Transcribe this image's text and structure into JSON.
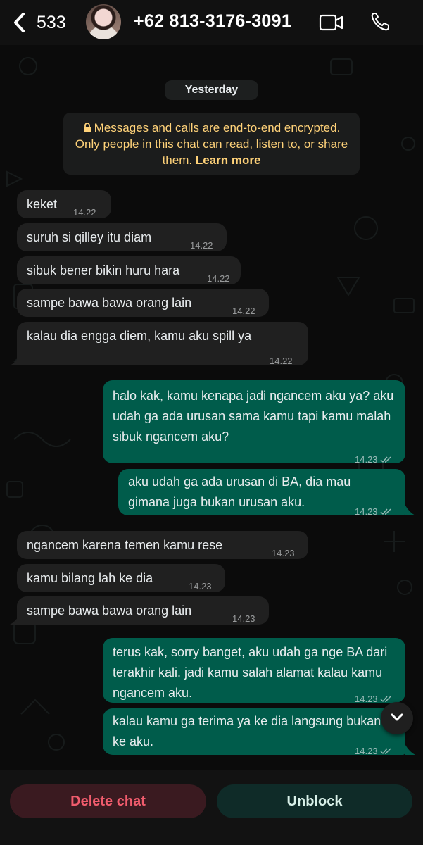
{
  "header": {
    "back_count": "533",
    "contact_name": "+62 813-3176-3091",
    "avatar_icon": "avatar-photo",
    "video_icon": "video-call-icon",
    "phone_icon": "voice-call-icon"
  },
  "chat": {
    "date_label": "Yesterday",
    "encryption": {
      "text": "Messages and calls are end-to-end encrypted. Only people in this chat can read, listen to, or share them.",
      "link": "Learn more"
    },
    "messages": [
      {
        "dir": "in",
        "text": "keket",
        "time": "14.22"
      },
      {
        "dir": "in",
        "text": "suruh si qilley itu diam",
        "time": "14.22"
      },
      {
        "dir": "in",
        "text": "sibuk bener bikin huru hara",
        "time": "14.22"
      },
      {
        "dir": "in",
        "text": "sampe bawa bawa orang lain",
        "time": "14.22"
      },
      {
        "dir": "in",
        "text": "kalau dia engga diem, kamu aku spill ya",
        "time": "14.22"
      },
      {
        "dir": "out",
        "text": "halo kak, kamu kenapa jadi ngancem aku ya? aku udah ga ada urusan sama kamu tapi kamu malah sibuk ngancem aku?",
        "time": "14.23"
      },
      {
        "dir": "out",
        "text": "aku udah ga ada urusan di BA, dia mau gimana juga bukan urusan aku.",
        "time": "14.23"
      },
      {
        "dir": "in",
        "text": "ngancem karena temen kamu rese",
        "time": "14.23"
      },
      {
        "dir": "in",
        "text": "kamu bilang lah ke dia",
        "time": "14.23"
      },
      {
        "dir": "in",
        "text": "sampe bawa bawa orang lain",
        "time": "14.23"
      },
      {
        "dir": "out",
        "text": "terus kak, sorry banget, aku udah ga nge BA dari terakhir kali. jadi kamu salah alamat kalau kamu ngancem aku.",
        "time": "14.23"
      },
      {
        "dir": "out",
        "text": "kalau kamu ga terima ya ke dia langsung bukan ke aku.",
        "time": "14.23"
      }
    ]
  },
  "footer": {
    "delete_label": "Delete chat",
    "unblock_label": "Unblock"
  },
  "colors": {
    "outgoing_bubble": "#005c4b",
    "incoming_bubble": "#202020",
    "encryption_text": "#ffd279",
    "delete_text": "#f15c6d"
  }
}
